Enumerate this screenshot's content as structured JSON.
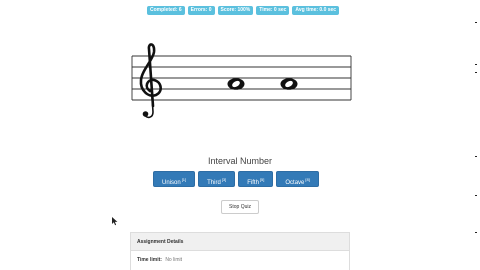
{
  "stats": [
    {
      "label": "Completed: 6"
    },
    {
      "label": "Errors: 0"
    },
    {
      "label": "Score: 100%"
    },
    {
      "label": "Time: 0 sec"
    },
    {
      "label": "Avg time: 0.0 sec"
    }
  ],
  "prompt": "Interval Number",
  "answers": [
    {
      "label": "Unison",
      "key": "[1]"
    },
    {
      "label": "Third",
      "key": "[3]"
    },
    {
      "label": "Fifth",
      "key": "[5]"
    },
    {
      "label": "Octave",
      "key": "[8]"
    }
  ],
  "stop_button": "Stop Quiz",
  "details": {
    "header": "Assignment Details",
    "time_limit_label": "Time limit:",
    "time_limit_value": "No limit"
  },
  "staff": {
    "clef": "treble-clef",
    "notes": [
      "C5",
      "C5"
    ],
    "note_type": "whole"
  }
}
